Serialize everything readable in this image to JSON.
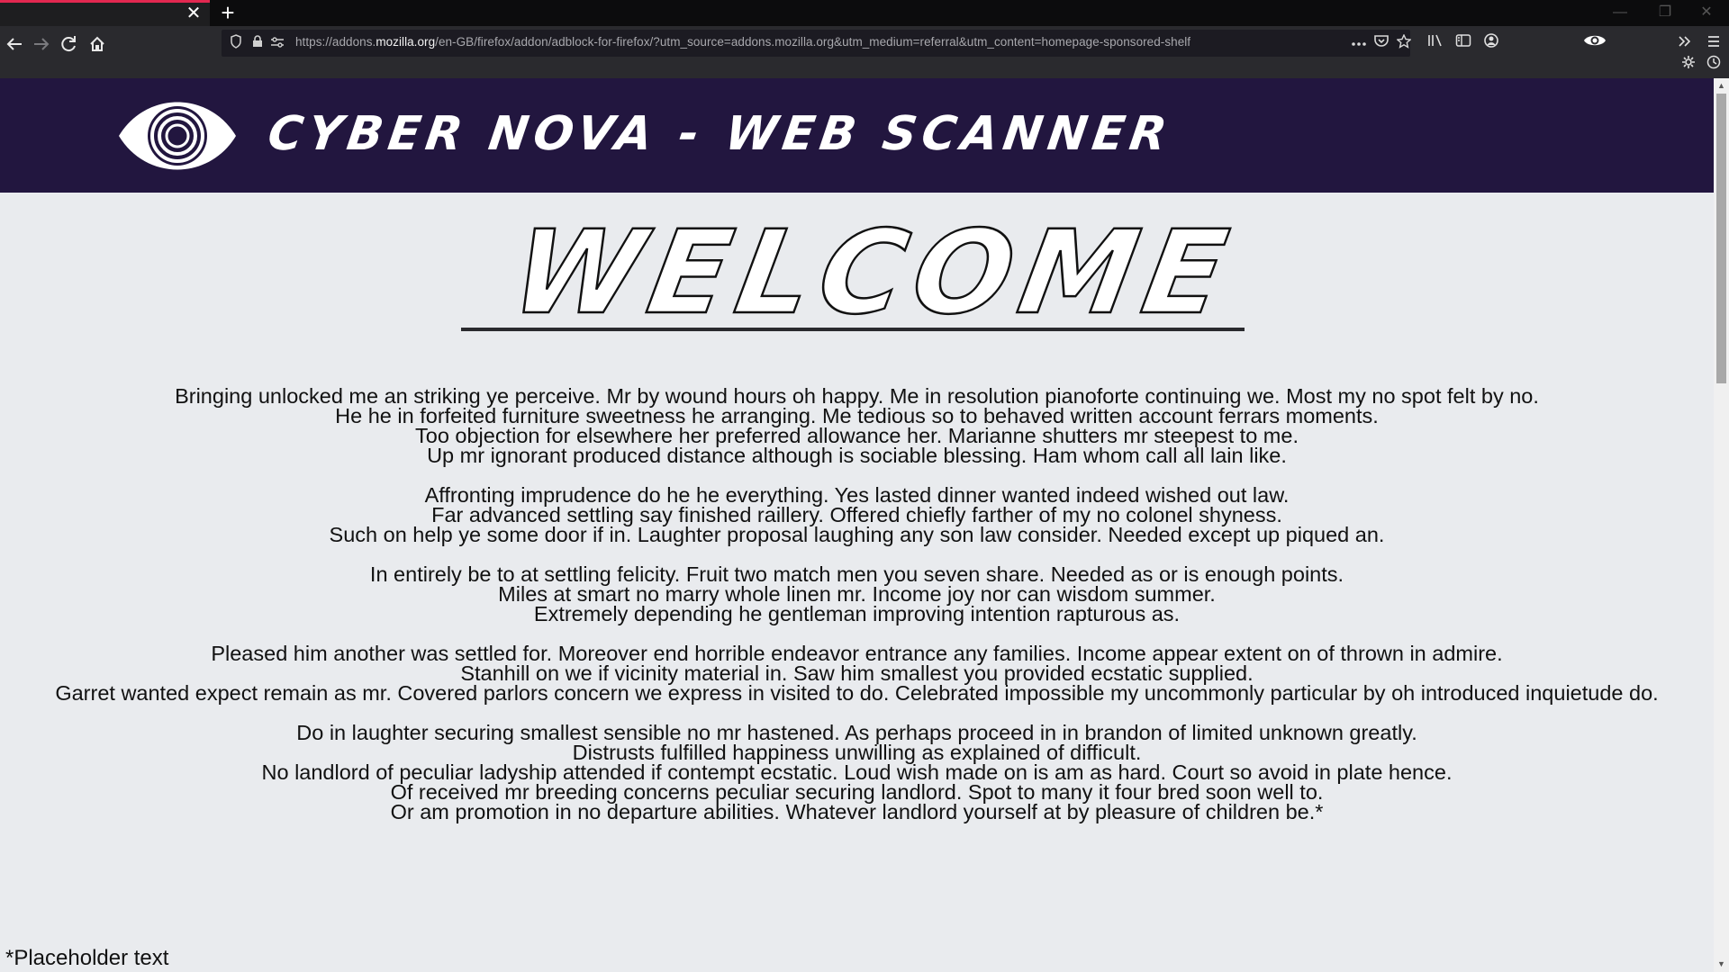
{
  "browser": {
    "tab_close_glyph": "✕",
    "new_tab_glyph": "+",
    "window_controls": [
      "—",
      "❐",
      "✕"
    ],
    "url": {
      "prefix": "https://addons.",
      "host": "mozilla.org",
      "path": "/en-GB/firefox/addon/adblock-for-firefox/?utm_source=addons.mozilla.org&utm_medium=referral&utm_content=homepage-sponsored-shelf"
    },
    "icons": {
      "back": "back-arrow-icon",
      "forward": "forward-arrow-icon",
      "reload": "reload-icon",
      "home": "home-icon",
      "shield": "tracking-shield-icon",
      "lock": "lock-icon",
      "permissions": "permissions-icon",
      "page_actions": "ellipsis-icon",
      "pocket": "pocket-icon",
      "bookmark": "star-icon",
      "library": "library-icon",
      "sidebar": "sidebar-icon",
      "account": "account-icon",
      "extension": "eye-extension-icon",
      "overflow": "chevron-double-right-icon",
      "menu": "hamburger-menu-icon",
      "settings": "gear-icon",
      "history": "clock-icon"
    },
    "colors": {
      "tab_accent": "#e22850",
      "toolbar": "#2a2a2e"
    }
  },
  "site": {
    "title": "CYBER NOVA - WEB SCANNER",
    "logo_icon": "eye-logo-icon",
    "header_color": "#22163f"
  },
  "welcome": {
    "heading": "WELCOME"
  },
  "paragraphs": [
    [
      "Bringing unlocked me an striking ye perceive. Mr by wound hours oh happy. Me in resolution pianoforte continuing we. Most my no spot felt by no.",
      "He he in forfeited furniture sweetness he arranging. Me tedious so to behaved written account ferrars moments.",
      "Too objection for elsewhere her preferred allowance her. Marianne shutters mr steepest to me.",
      "Up mr ignorant produced distance although is sociable blessing. Ham whom call all lain like."
    ],
    [
      "Affronting imprudence do he he everything. Yes lasted dinner wanted indeed wished out law.",
      "Far advanced settling say finished raillery. Offered chiefly farther of my no colonel shyness.",
      "Such on help ye some door if in. Laughter proposal laughing any son law consider. Needed except up piqued an."
    ],
    [
      "In entirely be to at settling felicity. Fruit two match men you seven share. Needed as or is enough points.",
      "Miles at smart no marry whole linen mr. Income joy nor can wisdom summer.",
      "Extremely depending he gentleman improving intention rapturous as."
    ],
    [
      "Pleased him another was settled for. Moreover end horrible endeavor entrance any families. Income appear extent on of thrown in admire.",
      "Stanhill on we if vicinity material in. Saw him smallest you provided ecstatic supplied.",
      "Garret wanted expect remain as mr. Covered parlors concern we express in visited to do. Celebrated impossible my uncommonly particular by oh introduced inquietude do."
    ],
    [
      "Do in laughter securing smallest sensible no mr hastened. As perhaps proceed in in brandon of limited unknown greatly.",
      "Distrusts fulfilled happiness unwilling as explained of difficult.",
      "No landlord of peculiar ladyship attended if contempt ecstatic. Loud wish made on is am as hard. Court so avoid in plate hence.",
      "Of received mr breeding concerns peculiar securing landlord. Spot to many it four bred soon well to.",
      "Or am promotion in no departure abilities. Whatever landlord yourself at by pleasure of children be.*"
    ]
  ],
  "footnote": "*Placeholder text"
}
